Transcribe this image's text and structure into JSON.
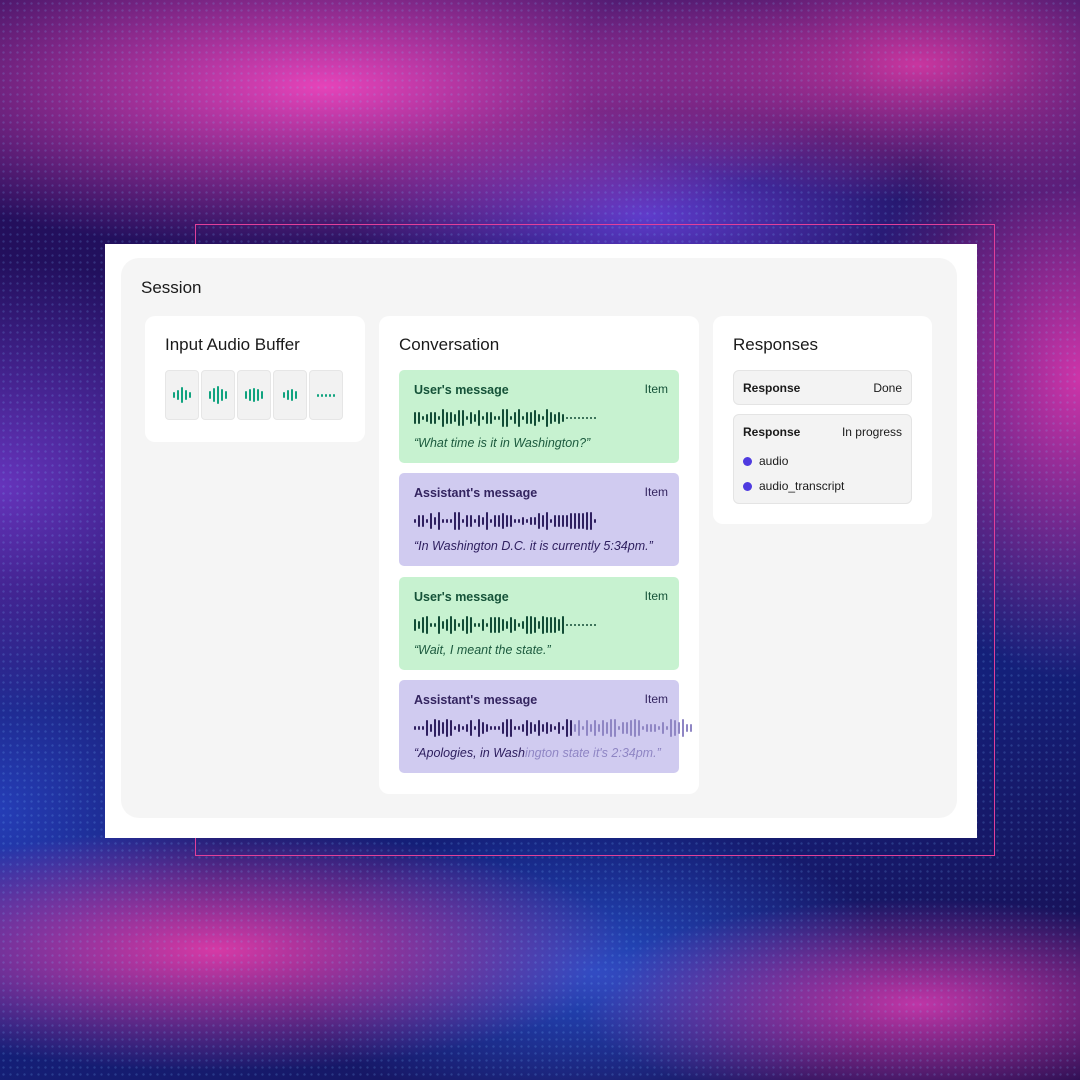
{
  "session": {
    "title": "Session"
  },
  "input_audio_buffer": {
    "title": "Input Audio Buffer",
    "cells": [
      [
        6,
        10,
        16,
        10,
        6
      ],
      [
        8,
        14,
        18,
        12,
        8
      ],
      [
        8,
        12,
        14,
        12,
        8
      ],
      [
        6,
        10,
        12,
        8
      ],
      [
        3,
        3,
        3,
        3,
        3
      ]
    ]
  },
  "conversation": {
    "title": "Conversation",
    "messages": [
      {
        "role": "User's message",
        "tag": "Item",
        "kind": "user",
        "text": "“What time is it in Washington?”",
        "text_faded": ""
      },
      {
        "role": "Assistant's message",
        "tag": "Item",
        "kind": "assistant",
        "text": "“In Washington D.C. it is currently 5:34pm.”",
        "text_faded": ""
      },
      {
        "role": "User's message",
        "tag": "Item",
        "kind": "user",
        "text": "“Wait, I meant the state.”",
        "text_faded": ""
      },
      {
        "role": "Assistant's message",
        "tag": "Item",
        "kind": "assistant",
        "text": "“Apologies, in Wash",
        "text_faded": "ington state it's 2:34pm.”"
      }
    ]
  },
  "responses": {
    "title": "Responses",
    "items": [
      {
        "label": "Response",
        "status": "Done",
        "outputs": []
      },
      {
        "label": "Response",
        "status": "In progress",
        "outputs": [
          "audio",
          "audio_transcript"
        ]
      }
    ]
  },
  "colors": {
    "user_bubble": "#c7f2d0",
    "assistant_bubble": "#d0cbf0",
    "buffer_wave": "#10a37f",
    "status_dot": "#4f3be0",
    "frame_accent": "#e0409a"
  }
}
